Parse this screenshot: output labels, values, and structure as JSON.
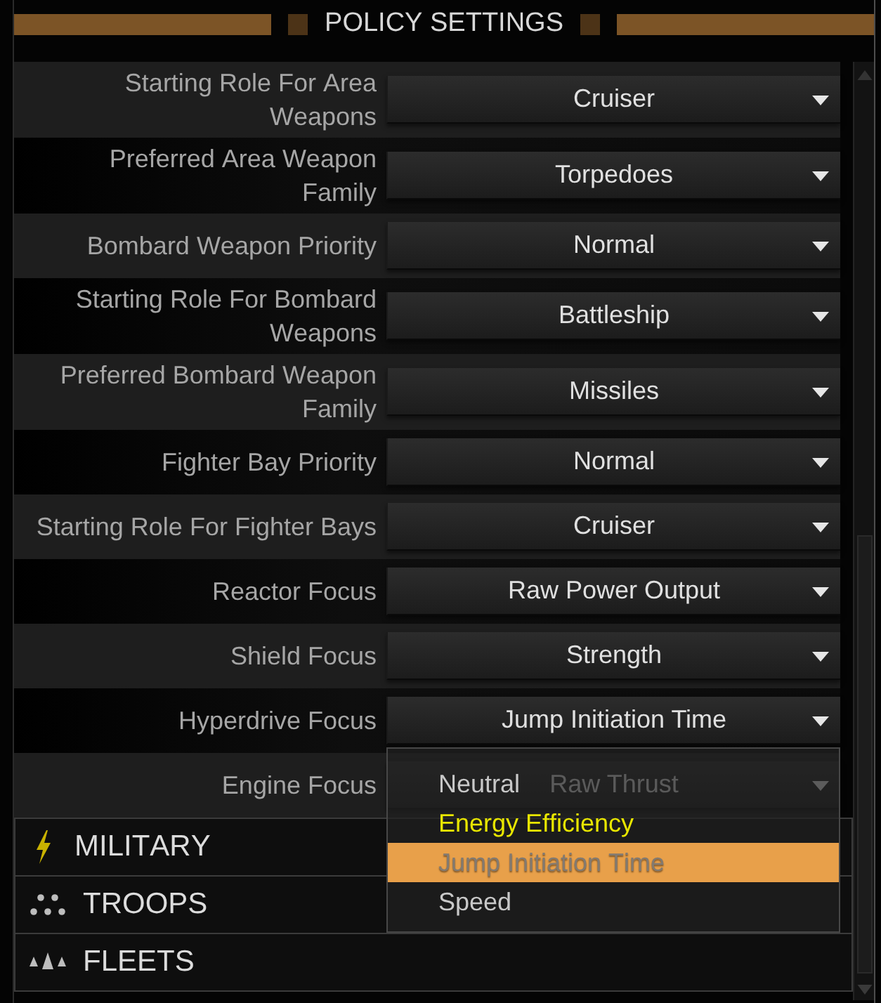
{
  "header": {
    "title": "POLICY SETTINGS"
  },
  "settings": [
    {
      "label": "Starting Role For Area Weapons",
      "value": "Cruiser"
    },
    {
      "label": "Preferred Area Weapon Family",
      "value": "Torpedoes"
    },
    {
      "label": "Bombard Weapon Priority",
      "value": "Normal"
    },
    {
      "label": "Starting Role For Bombard Weapons",
      "value": "Battleship"
    },
    {
      "label": "Preferred Bombard Weapon Family",
      "value": "Missiles"
    },
    {
      "label": "Fighter Bay Priority",
      "value": "Normal"
    },
    {
      "label": "Starting Role For Fighter Bays",
      "value": "Cruiser"
    },
    {
      "label": "Reactor Focus",
      "value": "Raw Power Output"
    },
    {
      "label": "Shield Focus",
      "value": "Strength"
    },
    {
      "label": "Hyperdrive Focus",
      "value": "Jump Initiation Time",
      "options": [
        {
          "label": "Neutral",
          "selected": false,
          "highlighted": false
        },
        {
          "label": "Energy Efficiency",
          "selected": false,
          "highlighted": true
        },
        {
          "label": "Jump Initiation Time",
          "selected": true,
          "highlighted": false
        },
        {
          "label": "Speed",
          "selected": false,
          "highlighted": false
        }
      ]
    },
    {
      "label": "Engine Focus",
      "value": "Raw Thrust"
    }
  ],
  "sections": [
    {
      "label": "MILITARY"
    },
    {
      "label": "TROOPS"
    },
    {
      "label": "FLEETS"
    }
  ]
}
